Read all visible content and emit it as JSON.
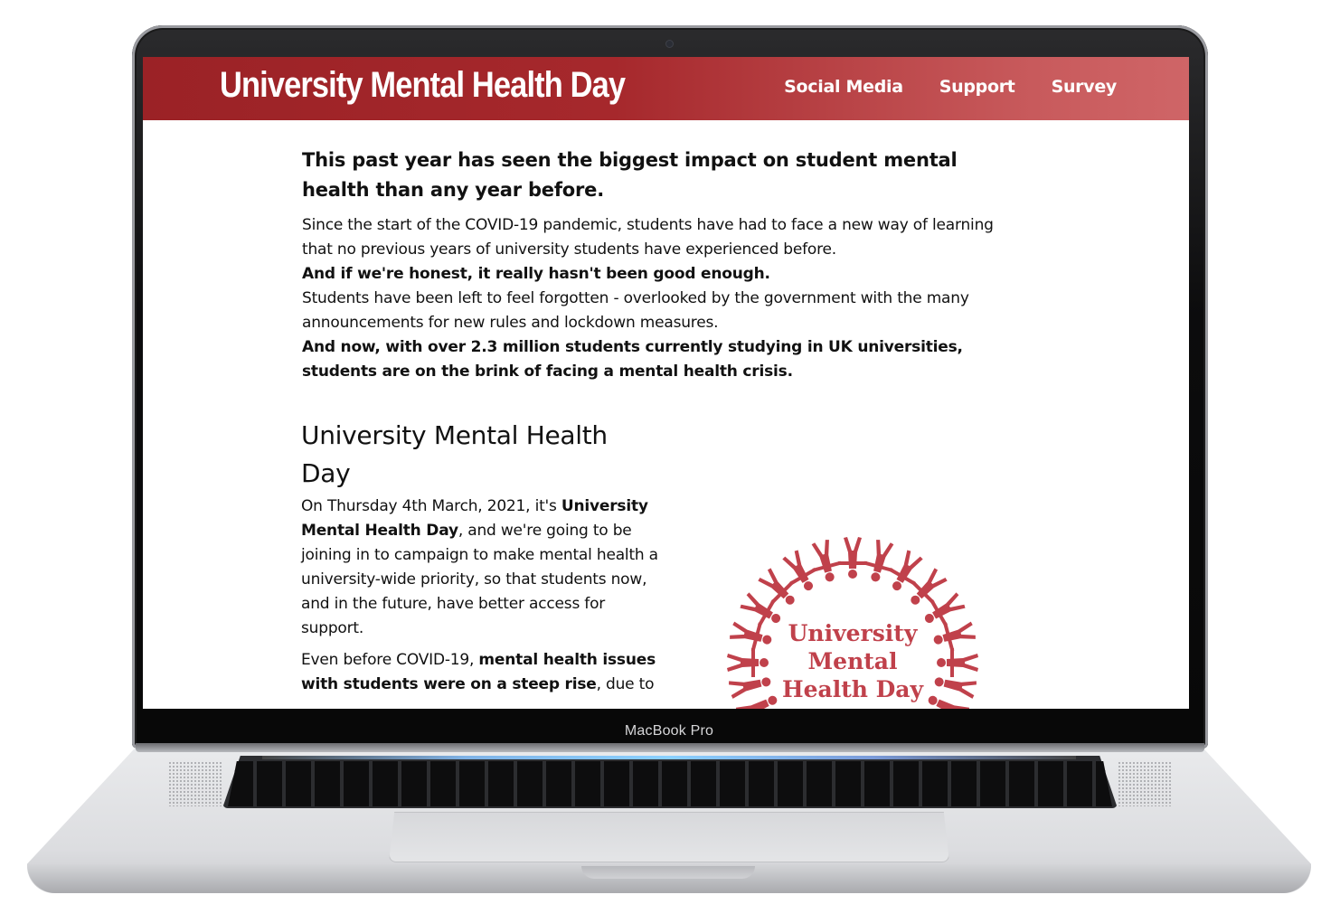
{
  "device": {
    "bezel_label": "MacBook Pro"
  },
  "site": {
    "title": "University Mental Health Day",
    "nav": [
      "Social Media",
      "Support",
      "Survey"
    ],
    "brand_color": "#9b2226"
  },
  "intro": {
    "heading": "This past year has seen the biggest impact on student mental health than any year before.",
    "p1": "Since the start of the COVID-19 pandemic, students have had to face a new way of learning that no previous years of university students have experienced before.",
    "p2": "And if we're honest, it really hasn't been good enough.",
    "p3": "Students have been left to feel forgotten - overlooked by the government with the many announcements for new rules and lockdown measures.",
    "p4": "And now, with over 2.3 million students currently studying in UK universities, students are on the brink of facing a mental health crisis."
  },
  "section": {
    "heading": "University Mental Health Day",
    "p1_a": "On Thursday 4th March, 2021, it's ",
    "p1_b": "University Mental Health Day",
    "p1_c": ", and we're going to be joining in to campaign to make mental health a university-wide priority, so that students now, and in the future, have better access for support.",
    "p2_a": "Even before COVID-19, ",
    "p2_b": "mental health issues with students were on a steep rise",
    "p2_c": ", due to"
  },
  "logo": {
    "line1": "University",
    "line2": "Mental",
    "line3": "Health Day",
    "color": "#c0414b"
  }
}
